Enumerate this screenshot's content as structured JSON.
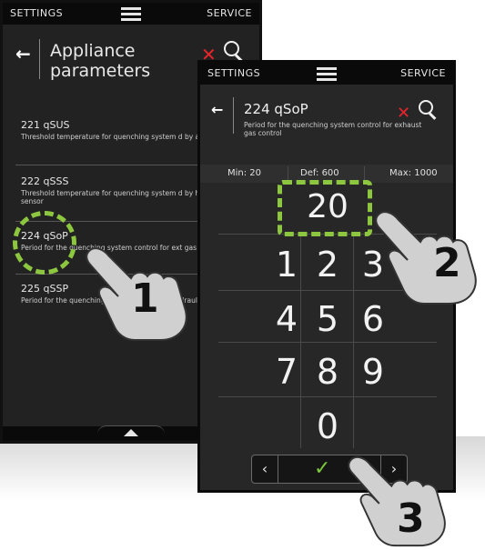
{
  "back_screen": {
    "topbar": {
      "left": "SETTINGS",
      "right": "SERVICE"
    },
    "title": "Appliance parameters",
    "params": [
      {
        "code": "221 qSUS",
        "desc": "Threshold temperature for quenching system d by air duct sensor"
      },
      {
        "code": "222 qSSS",
        "desc": "Threshold temperature for quenching system d by hydraulic drain sensor"
      },
      {
        "code": "224 qSoP",
        "desc": "Period for the quenching system control for ext gas control"
      },
      {
        "code": "225 qSSP",
        "desc": "Period for the quenching system control for hydraulic safety control"
      }
    ]
  },
  "front_screen": {
    "topbar": {
      "left": "SETTINGS",
      "right": "SERVICE"
    },
    "title": "224 qSoP",
    "desc": "Period for the quenching system control for exhaust gas control",
    "min": "Min: 20",
    "def": "Def: 600",
    "max": "Max: 1000",
    "value": "20",
    "keys": [
      "1",
      "2",
      "3",
      "4",
      "5",
      "6",
      "7",
      "8",
      "9",
      "0"
    ],
    "nav": {
      "prev": "‹",
      "next": "›",
      "confirm": "✓"
    }
  },
  "steps": [
    "1",
    "2",
    "3"
  ],
  "colors": {
    "accent_green": "#8dc63f",
    "close_red": "#e8252d",
    "screen_bg": "#272727"
  },
  "icons": [
    "menu-icon",
    "back-arrow-icon",
    "close-icon",
    "search-icon",
    "up-arrow-icon",
    "check-icon",
    "pointing-hand-icon"
  ]
}
